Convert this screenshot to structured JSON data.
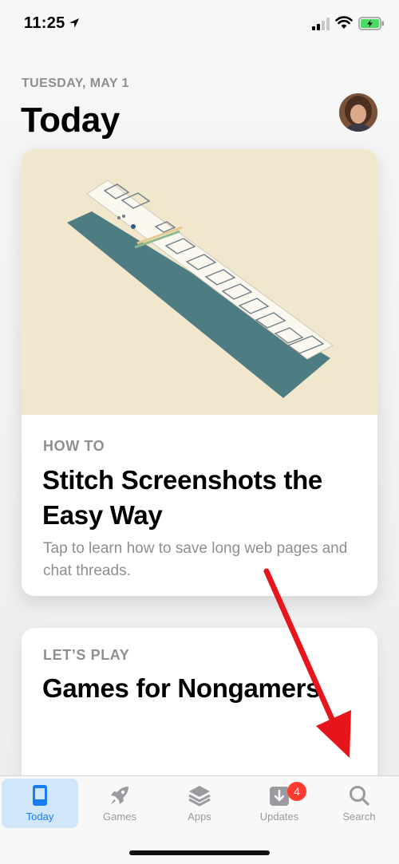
{
  "status_bar": {
    "time": "11:25"
  },
  "header": {
    "date": "TUESDAY, MAY 1",
    "title": "Today"
  },
  "cards": [
    {
      "eyebrow": "HOW TO",
      "title": "Stitch Screenshots the Easy Way",
      "description": "Tap to learn how to save long web pages and chat threads."
    },
    {
      "eyebrow": "LET’S PLAY",
      "title": "Games for Nongamers"
    }
  ],
  "tab_bar": {
    "tabs": [
      {
        "label": "Today",
        "icon": "today-icon",
        "selected": true
      },
      {
        "label": "Games",
        "icon": "rocket-icon"
      },
      {
        "label": "Apps",
        "icon": "layers-icon"
      },
      {
        "label": "Updates",
        "icon": "download-icon",
        "badge": "4"
      },
      {
        "label": "Search",
        "icon": "search-icon"
      }
    ]
  },
  "colors": {
    "accent": "#1a7cf5",
    "badge": "#ff3b30",
    "secondary_text": "#8e8e93",
    "art_background": "#f0e7cc",
    "annotation_arrow": "#e8141c"
  }
}
